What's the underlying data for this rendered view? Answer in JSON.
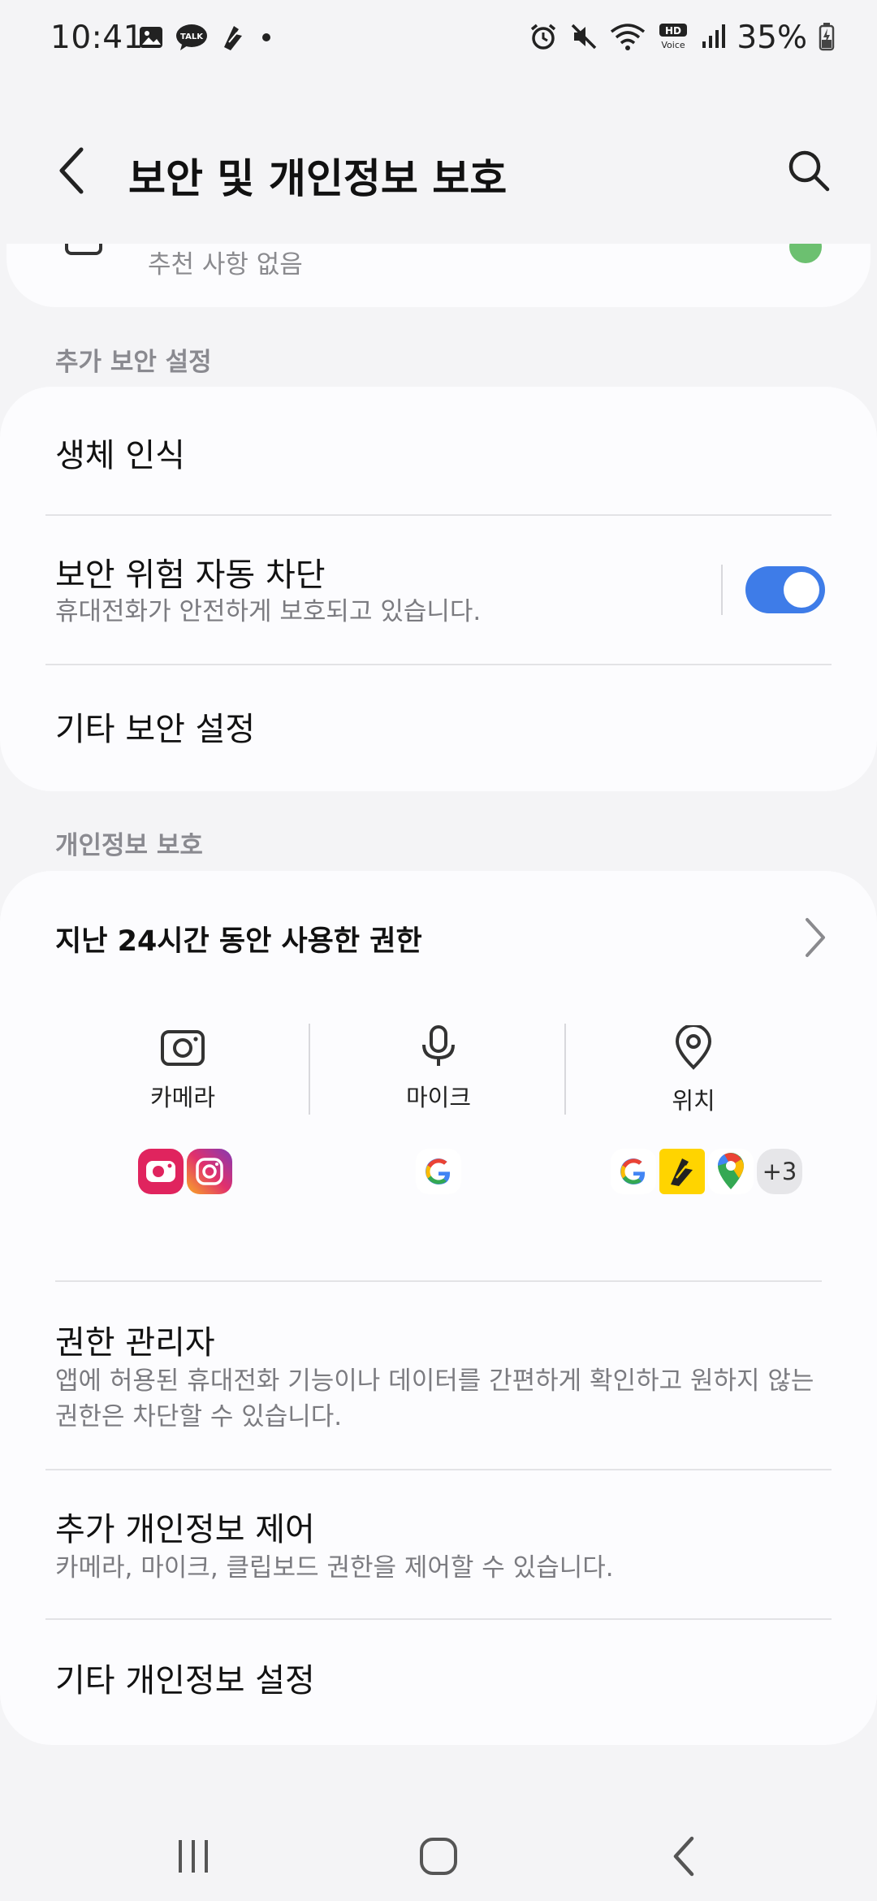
{
  "status_bar": {
    "time": "10:41",
    "battery_percent": "35%",
    "talk_badge": "TALK",
    "hd_label": "HD",
    "voice_label": "Voice"
  },
  "app_bar": {
    "title": "보안 및 개인정보 보호"
  },
  "top_card": {
    "subtitle": "추천 사항 없음"
  },
  "sections": {
    "security": {
      "label": "추가 보안 설정",
      "items": [
        {
          "title": "생체 인식"
        },
        {
          "title": "보안 위험 자동 차단",
          "subtitle": "휴대전화가 안전하게 보호되고 있습니다.",
          "toggle_on": true
        },
        {
          "title": "기타 보안 설정"
        }
      ]
    },
    "privacy": {
      "label": "개인정보 보호",
      "permissions_header": "지난 24시간 동안 사용한 권한",
      "permissions": [
        {
          "label": "카메라",
          "icon": "camera-icon"
        },
        {
          "label": "마이크",
          "icon": "microphone-icon"
        },
        {
          "label": "위치",
          "icon": "location-pin-icon"
        }
      ],
      "more_count": "+3",
      "items": [
        {
          "title": "권한 관리자",
          "subtitle_line1": "앱에 허용된 휴대전화 기능이나 데이터를 간편하게 확인하고 원하지 않는",
          "subtitle_line2": "권한은 차단할 수 있습니다."
        },
        {
          "title": "추가 개인정보 제어",
          "subtitle": "카메라, 마이크, 클립보드 권한을 제어할 수 있습니다."
        },
        {
          "title": "기타 개인정보 설정"
        }
      ]
    }
  },
  "colors": {
    "accent": "#3e7ce8",
    "background": "#f4f4f6",
    "card": "#fcfcfe"
  }
}
